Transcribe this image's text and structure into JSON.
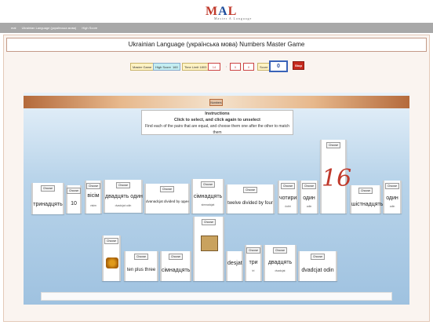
{
  "logo": {
    "m": "M",
    "a": "A",
    "l": "L",
    "sub": "Master A Language"
  },
  "navbar": {
    "items": [
      "mal",
      "Ukrainian Language (українська мова)",
      "High Score"
    ]
  },
  "title": "Ukrainian Language (українська мова) Numbers Master Game",
  "controls": {
    "master_game": "Master Game",
    "high_score_label": "High Score",
    "high_score": "160",
    "time_limit_label": "Time Limit 1803",
    "time_value": "14",
    "sep1": ":",
    "min": "0",
    "sep2": ":",
    "sec": "0",
    "score_label": "Score",
    "score": "0",
    "stop": "Stop"
  },
  "band_button": "Numbers",
  "instructions": {
    "title": "Instructions",
    "line1": "Click to select, and click again to unselect",
    "line2": "Find each of the pairs that are equal, and choose them one after the other to match them"
  },
  "choose": "Choose",
  "cards_row1": [
    {
      "big": "тринадцять",
      "small": ""
    },
    {
      "big": "10",
      "small": ""
    },
    {
      "big": "вісім",
      "small": "visim"
    },
    {
      "big": "двадцять один",
      "small": "dvadcjat odin"
    },
    {
      "big": "dvanadcjat divided by один",
      "small": ""
    },
    {
      "big": "сімнадцять",
      "small": "simnadcjat"
    },
    {
      "big": "twelve divided by four",
      "small": ""
    },
    {
      "big": "чотири",
      "small": "čotiri"
    },
    {
      "big": "один",
      "small": "odin"
    },
    {
      "big": "16",
      "small": ""
    },
    {
      "big": "шістнадцять",
      "small": ""
    },
    {
      "big": "один",
      "small": "odin"
    }
  ],
  "cards_row2": [
    {
      "big": "",
      "small": ""
    },
    {
      "big": "ten plus three",
      "small": ""
    },
    {
      "big": "сімнадцять",
      "small": ""
    },
    {
      "big": "",
      "small": ""
    },
    {
      "big": "desjat",
      "small": ""
    },
    {
      "big": "три",
      "small": "tri"
    },
    {
      "big": "двадцять",
      "small": "dvadcjat"
    },
    {
      "big": "dvadcjat odin",
      "small": ""
    }
  ]
}
